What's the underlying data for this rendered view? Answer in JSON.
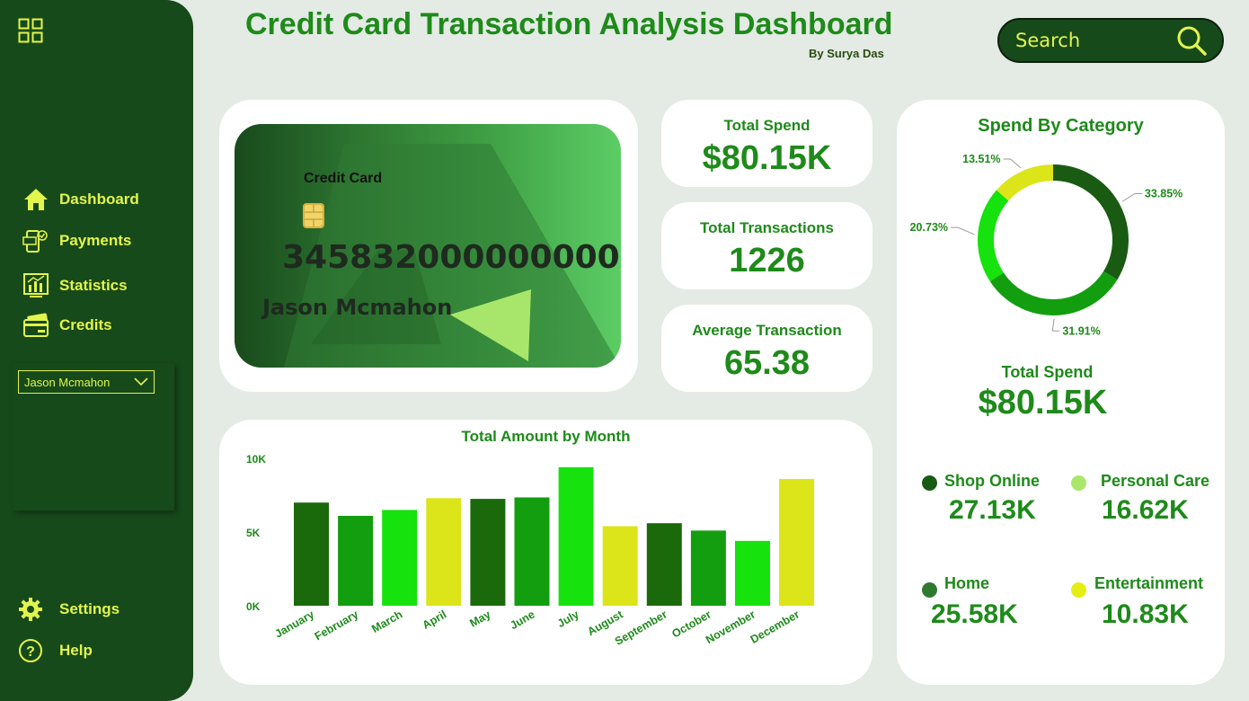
{
  "header": {
    "title": "Credit Card Transaction Analysis Dashboard",
    "subtitle": "By Surya Das"
  },
  "search": {
    "placeholder": "Search"
  },
  "sidebar": {
    "items": [
      {
        "label": "Dashboard",
        "icon": "home-icon"
      },
      {
        "label": "Payments",
        "icon": "payments-icon"
      },
      {
        "label": "Statistics",
        "icon": "statistics-icon"
      },
      {
        "label": "Credits",
        "icon": "credit-card-icon"
      }
    ],
    "footer": [
      {
        "label": "Settings",
        "icon": "gear-icon"
      },
      {
        "label": "Help",
        "icon": "help-icon"
      }
    ],
    "slicer_value": "Jason Mcmahon"
  },
  "card": {
    "label": "Credit Card",
    "number": "345832000000000",
    "holder": "Jason Mcmahon"
  },
  "kpis": [
    {
      "title": "Total Spend",
      "value": "$80.15K"
    },
    {
      "title": "Total Transactions",
      "value": "1226"
    },
    {
      "title": "Average Transaction",
      "value": "65.38"
    }
  ],
  "spend_panel": {
    "title": "Spend By Category",
    "total_label": "Total Spend",
    "total_value": "$80.15K",
    "categories": [
      {
        "name": "Shop Online",
        "value": "27.13K",
        "color": "#1a5b14"
      },
      {
        "name": "Personal Care",
        "value": "16.62K",
        "color": "#a9e66b"
      },
      {
        "name": "Home",
        "value": "25.58K",
        "color": "#2e7a30"
      },
      {
        "name": "Entertainment",
        "value": "10.83K",
        "color": "#e5ee12"
      }
    ]
  },
  "colors": {
    "sidebar": "#174a1a",
    "accent": "#e2f54d",
    "title_green": "#1e8a1a",
    "background": "#e3ebe4"
  },
  "chart_data": [
    {
      "type": "bar",
      "title": "Total Amount by Month",
      "categories": [
        "January",
        "February",
        "March",
        "April",
        "May",
        "June",
        "July",
        "August",
        "September",
        "October",
        "November",
        "December"
      ],
      "values": [
        7000,
        6100,
        6500,
        7300,
        7250,
        7350,
        9400,
        5400,
        5600,
        5100,
        4400,
        8600
      ],
      "colors": [
        "#1a6a0c",
        "#139e0f",
        "#16e20d",
        "#dce41a",
        "#1a6a0c",
        "#139e0f",
        "#16e20d",
        "#dce41a",
        "#1a6a0c",
        "#139e0f",
        "#16e20d",
        "#dce41a"
      ],
      "ylim": [
        0,
        10000
      ],
      "yticks": [
        "0K",
        "5K",
        "10K"
      ],
      "grid": false
    },
    {
      "type": "pie",
      "title": "Spend By Category",
      "labels": [
        "33.85%",
        "31.91%",
        "20.73%",
        "13.51%"
      ],
      "values": [
        33.85,
        31.91,
        20.73,
        13.51
      ],
      "colors": [
        "#1a5b14",
        "#139e0f",
        "#16e20d",
        "#dce41a"
      ]
    }
  ]
}
